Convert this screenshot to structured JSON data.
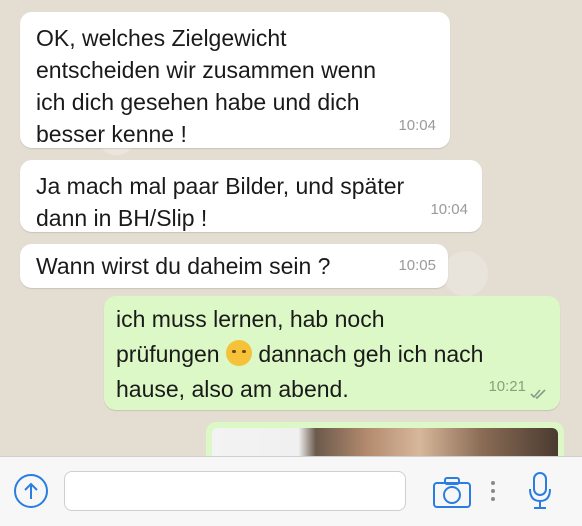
{
  "messages": [
    {
      "direction": "incoming",
      "lines": [
        "OK, welches Zielgewicht",
        "entscheiden wir zusammen wenn",
        "ich dich gesehen habe und dich",
        "besser kenne !"
      ],
      "time": "10:04"
    },
    {
      "direction": "incoming",
      "lines": [
        "Ja mach mal paar Bilder, und später",
        "dann in BH/Slip !"
      ],
      "time": "10:04"
    },
    {
      "direction": "incoming",
      "lines": [
        "Wann wirst du daheim sein ?"
      ],
      "time": "10:05"
    },
    {
      "direction": "outgoing",
      "line1": "ich muss lernen, hab noch",
      "line2_before_emoji": "prüfungen",
      "emoji": "sad-face-emoji",
      "line2_after_emoji": "dannach geh ich nach",
      "line3": "hause, also am abend.",
      "time": "10:21",
      "status": "read-double-check"
    }
  ],
  "photo_message": {
    "direction": "outgoing",
    "content": "photo"
  },
  "input_bar": {
    "upload_icon": "upload-arrow-icon",
    "text_value": "",
    "camera_icon": "camera-icon",
    "more_icon": "vertical-dots-icon",
    "mic_icon": "microphone-icon"
  },
  "colors": {
    "incoming_bubble": "#ffffff",
    "outgoing_bubble": "#dcf8c6",
    "accent": "#2a7de1"
  }
}
